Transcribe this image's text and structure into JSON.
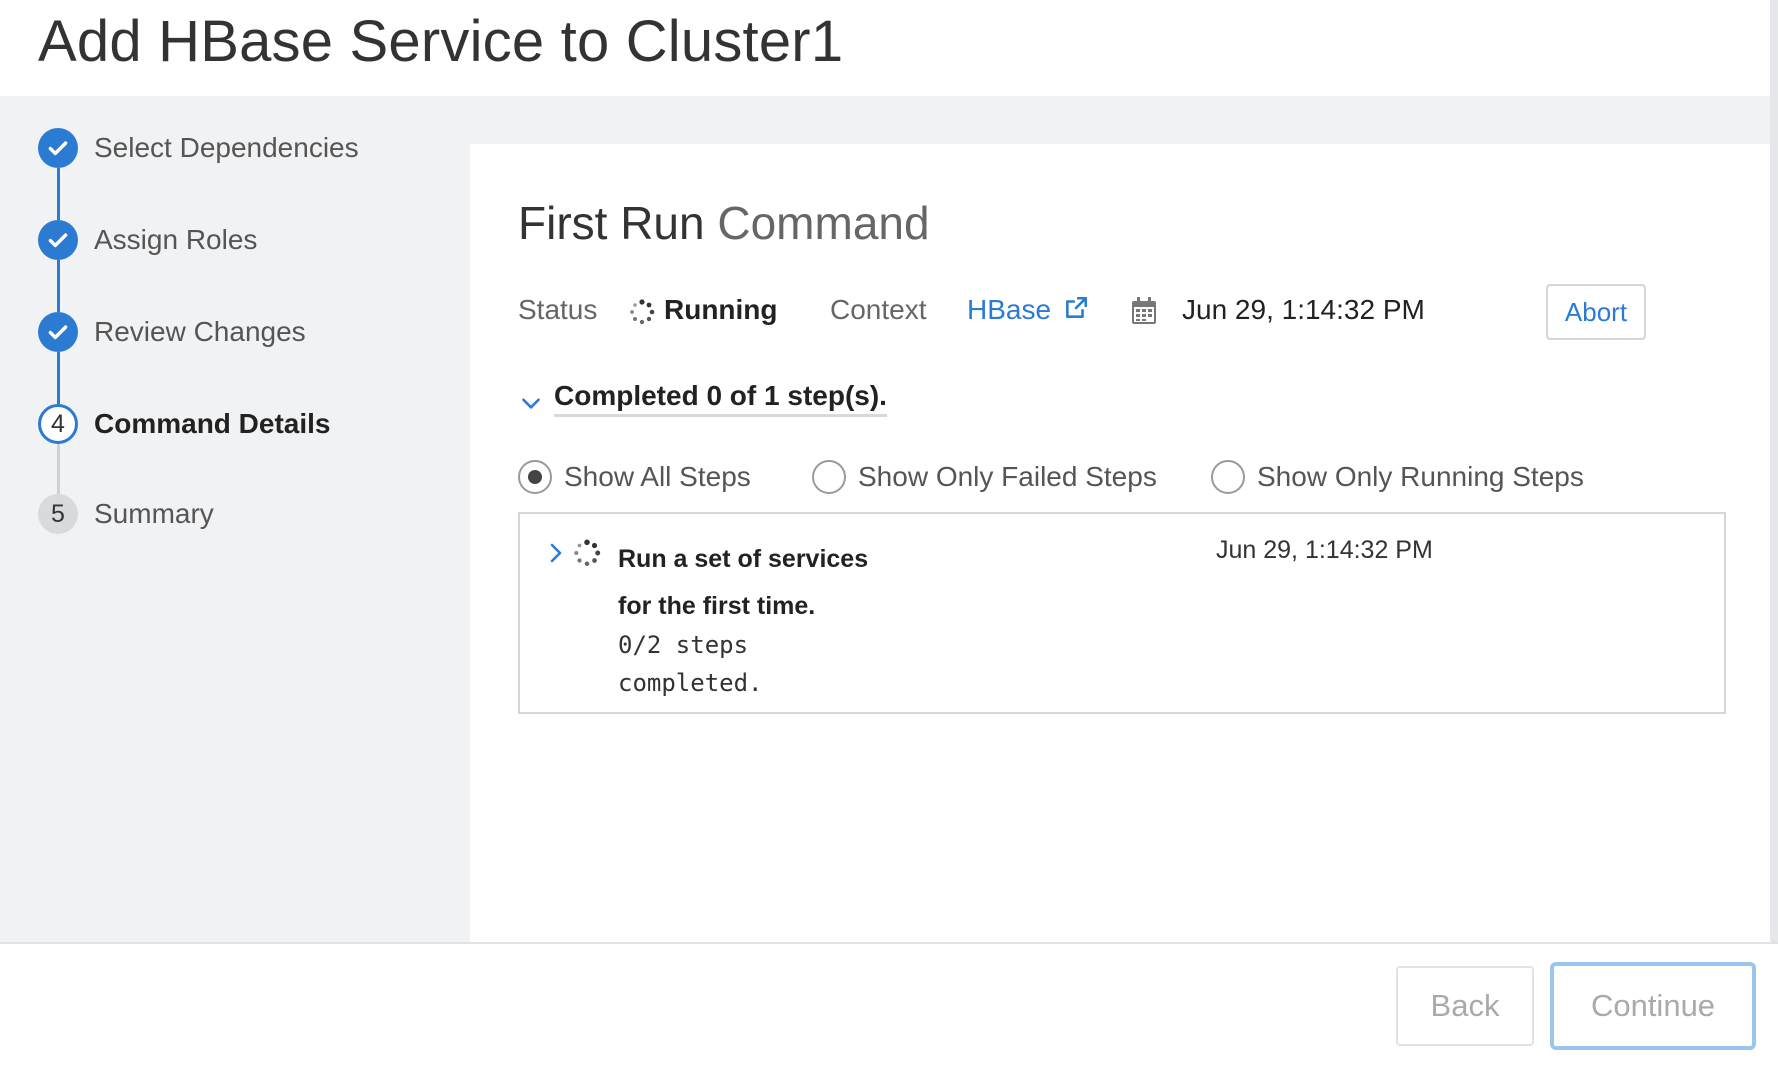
{
  "header": {
    "title": "Add HBase Service to Cluster1"
  },
  "wizard_steps": [
    {
      "label": "Select Dependencies",
      "state": "done"
    },
    {
      "label": "Assign Roles",
      "state": "done"
    },
    {
      "label": "Review Changes",
      "state": "done"
    },
    {
      "number": "4",
      "label": "Command Details",
      "state": "current"
    },
    {
      "number": "5",
      "label": "Summary",
      "state": "pending"
    }
  ],
  "command": {
    "title_prefix": "First Run",
    "title_suffix": "Command",
    "status_label": "Status",
    "status_value": "Running",
    "context_label": "Context",
    "context_value": "HBase",
    "timestamp": "Jun 29, 1:14:32 PM",
    "abort_label": "Abort"
  },
  "progress": {
    "summary": "Completed 0 of 1 step(s)."
  },
  "filters": {
    "selected": "Show All Steps",
    "options": [
      "Show All Steps",
      "Show Only Failed Steps",
      "Show Only Running Steps"
    ]
  },
  "steps_table": [
    {
      "title": "Run a set of services for the first time.",
      "time": "Jun 29, 1:14:32 PM",
      "sub": "0/2 steps completed."
    }
  ],
  "footer": {
    "back_label": "Back",
    "continue_label": "Continue"
  },
  "colors": {
    "accent": "#2b7bd3",
    "sidebar_bg": "#f1f2f4",
    "focus_ring": "#9bc4ef"
  },
  "icons": {
    "done_step": "check-icon",
    "status": "spinner-icon",
    "context_link": "external-link-icon",
    "timestamp": "calendar-icon",
    "toggle": "chevron-down-icon",
    "row_expand": "chevron-right-icon"
  }
}
